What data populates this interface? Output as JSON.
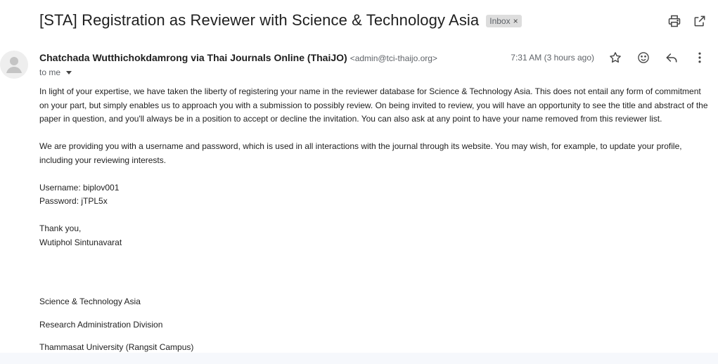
{
  "email": {
    "subject": "[STA] Registration as Reviewer with Science & Technology Asia",
    "label": "Inbox",
    "label_remove": "×",
    "sender_name": "Chatchada Wutthichokdamrong via Thai Journals Online (ThaiJO)",
    "sender_email": "<admin@tci-thaijo.org>",
    "to": "to me",
    "timestamp": "7:31 AM (3 hours ago)",
    "body": {
      "p1": "In light of your expertise, we have taken the liberty of registering your name in the reviewer database for Science & Technology Asia. This does not entail any form of commitment on your part, but simply enables us to approach you with a submission to possibly review. On being invited to review, you will have an opportunity to see the title and abstract of the paper in question, and you'll always be in a position to accept or decline the invitation. You can also ask at any point to have your name removed from this reviewer list.",
      "p2": "We are providing you with a username and password, which is used in all interactions with the journal through its website. You may wish, for example, to update your profile, including your reviewing interests.",
      "username": "Username: biplov001",
      "password": "Password: jTPL5x",
      "thanks": "Thank you,",
      "signer": "Wutiphol Sintunavarat",
      "org1": "Science & Technology Asia",
      "org2": "Research Administration Division",
      "org3": "Thammasat University (Rangsit Campus)"
    }
  },
  "icons": {
    "print": "print-icon",
    "open_new": "open-in-new-window-icon",
    "star": "star-icon",
    "emoji": "emoji-reaction-icon",
    "reply": "reply-icon",
    "more": "more-vertical-icon",
    "avatar": "person-avatar-icon"
  },
  "colors": {
    "text": "#202124",
    "secondary": "#5f6368",
    "chip_bg": "#dddddd"
  }
}
